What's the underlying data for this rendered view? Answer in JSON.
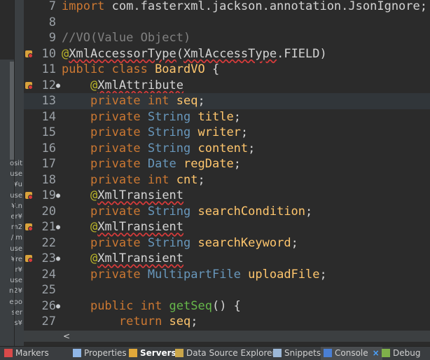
{
  "explorer_fragments": [
    "osit",
    "use",
    "¥u",
    "use",
    "¥.n",
    "er¥",
    "m2",
    "/.m",
    "use",
    "¥re",
    "r¥",
    "use",
    "n2¥",
    "epo",
    "ser",
    "s¥"
  ],
  "code_lines": [
    {
      "num": "7",
      "fold": "",
      "marker": false,
      "current": false,
      "tokens": [
        {
          "c": "kw",
          "t": "import "
        },
        {
          "c": "tx",
          "t": "com.fasterxml.jackson.annotation.JsonIgnore;"
        }
      ]
    },
    {
      "num": "8",
      "fold": "",
      "marker": false,
      "current": false,
      "tokens": []
    },
    {
      "num": "9",
      "fold": "",
      "marker": false,
      "current": false,
      "tokens": [
        {
          "c": "cm",
          "t": "//VO(Value Object)"
        }
      ]
    },
    {
      "num": "10",
      "fold": "",
      "marker": true,
      "current": false,
      "tokens": [
        {
          "c": "an",
          "t": "@"
        },
        {
          "c": "err",
          "t": "XmlAccessorType"
        },
        {
          "c": "tx",
          "t": "("
        },
        {
          "c": "err",
          "t": "XmlAccessType"
        },
        {
          "c": "tx",
          "t": ".FIELD)"
        }
      ]
    },
    {
      "num": "11",
      "fold": "",
      "marker": false,
      "current": false,
      "tokens": [
        {
          "c": "kw",
          "t": "public class "
        },
        {
          "c": "id",
          "t": "BoardVO"
        },
        {
          "c": "tx",
          "t": " {"
        }
      ]
    },
    {
      "num": "12",
      "fold": "●",
      "marker": true,
      "current": false,
      "tokens": [
        {
          "c": "tx",
          "t": "    "
        },
        {
          "c": "an",
          "t": "@"
        },
        {
          "c": "err",
          "t": "XmlAttribute"
        }
      ]
    },
    {
      "num": "13",
      "fold": "",
      "marker": false,
      "current": true,
      "tokens": [
        {
          "c": "tx",
          "t": "    "
        },
        {
          "c": "kw",
          "t": "private int "
        },
        {
          "c": "id",
          "t": "seq"
        },
        {
          "c": "tx",
          "t": ";"
        }
      ]
    },
    {
      "num": "14",
      "fold": "",
      "marker": false,
      "current": false,
      "tokens": [
        {
          "c": "tx",
          "t": "    "
        },
        {
          "c": "kw",
          "t": "private "
        },
        {
          "c": "ty",
          "t": "String "
        },
        {
          "c": "id",
          "t": "title"
        },
        {
          "c": "tx",
          "t": ";"
        }
      ]
    },
    {
      "num": "15",
      "fold": "",
      "marker": false,
      "current": false,
      "tokens": [
        {
          "c": "tx",
          "t": "    "
        },
        {
          "c": "kw",
          "t": "private "
        },
        {
          "c": "ty",
          "t": "String "
        },
        {
          "c": "id",
          "t": "writer"
        },
        {
          "c": "tx",
          "t": ";"
        }
      ]
    },
    {
      "num": "16",
      "fold": "",
      "marker": false,
      "current": false,
      "tokens": [
        {
          "c": "tx",
          "t": "    "
        },
        {
          "c": "kw",
          "t": "private "
        },
        {
          "c": "ty",
          "t": "String "
        },
        {
          "c": "id",
          "t": "content"
        },
        {
          "c": "tx",
          "t": ";"
        }
      ]
    },
    {
      "num": "17",
      "fold": "",
      "marker": false,
      "current": false,
      "tokens": [
        {
          "c": "tx",
          "t": "    "
        },
        {
          "c": "kw",
          "t": "private "
        },
        {
          "c": "ty",
          "t": "Date "
        },
        {
          "c": "id",
          "t": "regDate"
        },
        {
          "c": "tx",
          "t": ";"
        }
      ]
    },
    {
      "num": "18",
      "fold": "",
      "marker": false,
      "current": false,
      "tokens": [
        {
          "c": "tx",
          "t": "    "
        },
        {
          "c": "kw",
          "t": "private int "
        },
        {
          "c": "id",
          "t": "cnt"
        },
        {
          "c": "tx",
          "t": ";"
        }
      ]
    },
    {
      "num": "19",
      "fold": "●",
      "marker": true,
      "current": false,
      "tokens": [
        {
          "c": "tx",
          "t": "    "
        },
        {
          "c": "an",
          "t": "@"
        },
        {
          "c": "err",
          "t": "XmlTransient"
        }
      ]
    },
    {
      "num": "20",
      "fold": "",
      "marker": false,
      "current": false,
      "tokens": [
        {
          "c": "tx",
          "t": "    "
        },
        {
          "c": "kw",
          "t": "private "
        },
        {
          "c": "ty",
          "t": "String "
        },
        {
          "c": "id",
          "t": "searchCondition"
        },
        {
          "c": "tx",
          "t": ";"
        }
      ]
    },
    {
      "num": "21",
      "fold": "●",
      "marker": true,
      "current": false,
      "tokens": [
        {
          "c": "tx",
          "t": "    "
        },
        {
          "c": "an",
          "t": "@"
        },
        {
          "c": "err",
          "t": "XmlTransient"
        }
      ]
    },
    {
      "num": "22",
      "fold": "",
      "marker": false,
      "current": false,
      "tokens": [
        {
          "c": "tx",
          "t": "    "
        },
        {
          "c": "kw",
          "t": "private "
        },
        {
          "c": "ty",
          "t": "String "
        },
        {
          "c": "id",
          "t": "searchKeyword"
        },
        {
          "c": "tx",
          "t": ";"
        }
      ]
    },
    {
      "num": "23",
      "fold": "●",
      "marker": true,
      "current": false,
      "tokens": [
        {
          "c": "tx",
          "t": "    "
        },
        {
          "c": "an",
          "t": "@"
        },
        {
          "c": "err",
          "t": "XmlTransient"
        }
      ]
    },
    {
      "num": "24",
      "fold": "",
      "marker": false,
      "current": false,
      "tokens": [
        {
          "c": "tx",
          "t": "    "
        },
        {
          "c": "kw",
          "t": "private "
        },
        {
          "c": "ty",
          "t": "MultipartFile "
        },
        {
          "c": "id",
          "t": "uploadFile"
        },
        {
          "c": "tx",
          "t": ";"
        }
      ]
    },
    {
      "num": "25",
      "fold": "",
      "marker": false,
      "current": false,
      "tokens": []
    },
    {
      "num": "26",
      "fold": "●",
      "marker": false,
      "current": false,
      "tokens": [
        {
          "c": "tx",
          "t": "    "
        },
        {
          "c": "kw",
          "t": "public int "
        },
        {
          "c": "mt",
          "t": "getSeq"
        },
        {
          "c": "tx",
          "t": "() {"
        }
      ]
    },
    {
      "num": "27",
      "fold": "",
      "marker": false,
      "current": false,
      "tokens": [
        {
          "c": "tx",
          "t": "        "
        },
        {
          "c": "kw",
          "t": "return "
        },
        {
          "c": "id",
          "t": "seq"
        },
        {
          "c": "tx",
          "t": ";"
        }
      ]
    }
  ],
  "scroll_left_arrow": "<",
  "tabs": [
    {
      "id": "markers",
      "label": "Markers",
      "icon": "markers-icon",
      "color": "#d94a4a",
      "active": false,
      "bold": false
    },
    {
      "id": "properties",
      "label": "Properties",
      "icon": "properties-icon",
      "color": "#8fb6e6",
      "active": false,
      "bold": false
    },
    {
      "id": "servers",
      "label": "Servers",
      "icon": "servers-icon",
      "color": "#e0a83a",
      "active": false,
      "bold": true
    },
    {
      "id": "data-source-explorer",
      "label": "Data Source Explorer",
      "icon": "data-source-icon",
      "color": "#caa64a",
      "active": false,
      "bold": false
    },
    {
      "id": "snippets",
      "label": "Snippets",
      "icon": "snippets-icon",
      "color": "#9cb8d8",
      "active": false,
      "bold": false
    },
    {
      "id": "console",
      "label": "Console",
      "icon": "console-icon",
      "color": "#4a7fd4",
      "active": true,
      "bold": false
    },
    {
      "id": "debug",
      "label": "Debug",
      "icon": "debug-icon",
      "color": "#7fb04a",
      "active": false,
      "bold": false
    }
  ],
  "console_close": "×"
}
